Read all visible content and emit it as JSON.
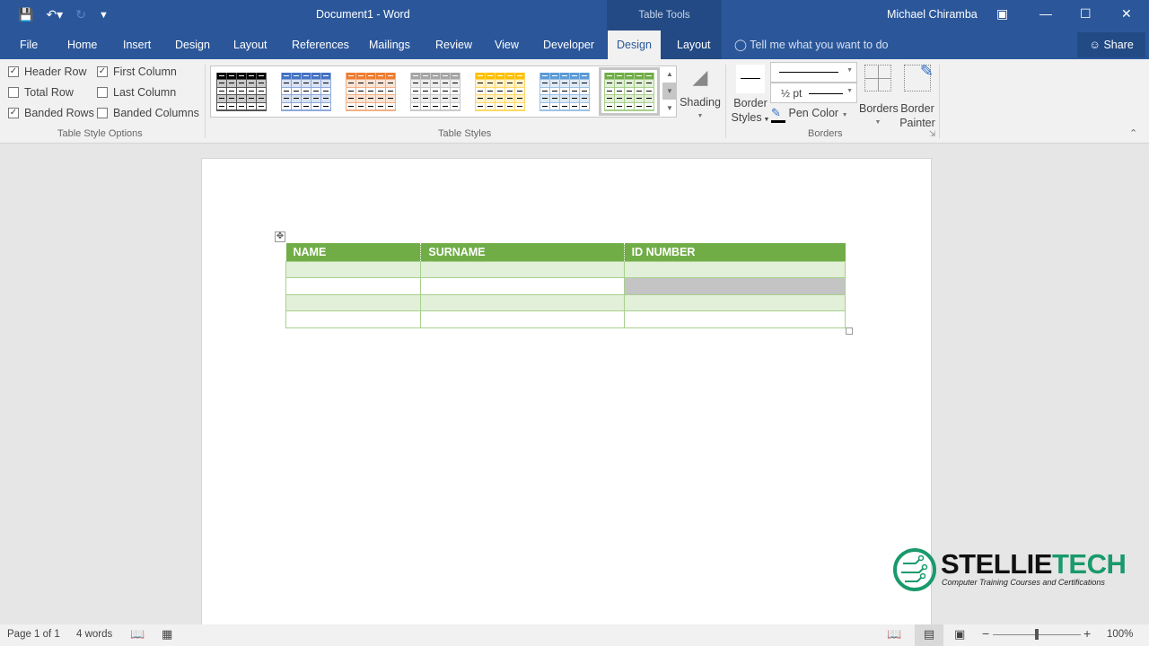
{
  "app": {
    "title": "Document1  -  Word",
    "context_tab_header": "Table Tools",
    "user": "Michael Chiramba"
  },
  "qat": {
    "save_icon": "save-icon",
    "undo_icon": "undo-icon",
    "redo_icon": "redo-icon",
    "customize_icon": "customize-qat-icon"
  },
  "window_controls": {
    "ribbon_display": "ribbon-display-options-icon",
    "minimize": "minimize-icon",
    "maximize": "maximize-icon",
    "close": "close-icon"
  },
  "tabs": [
    {
      "label": "File"
    },
    {
      "label": "Home"
    },
    {
      "label": "Insert"
    },
    {
      "label": "Design"
    },
    {
      "label": "Layout"
    },
    {
      "label": "References"
    },
    {
      "label": "Mailings"
    },
    {
      "label": "Review"
    },
    {
      "label": "View"
    },
    {
      "label": "Developer"
    },
    {
      "label": "Design",
      "active": true,
      "context": true
    },
    {
      "label": "Layout",
      "context": true
    }
  ],
  "tellme": {
    "placeholder": "Tell me what you want to do"
  },
  "share": {
    "label": "Share"
  },
  "ribbon": {
    "style_options": {
      "label": "Table Style Options",
      "items": [
        {
          "label": "Header Row",
          "checked": true
        },
        {
          "label": "Total Row",
          "checked": false
        },
        {
          "label": "Banded Rows",
          "checked": true
        },
        {
          "label": "First Column",
          "checked": true
        },
        {
          "label": "Last Column",
          "checked": false
        },
        {
          "label": "Banded Columns",
          "checked": false
        }
      ]
    },
    "table_styles": {
      "label": "Table Styles",
      "thumbs": [
        {
          "name": "black",
          "header": "#000000",
          "band": "#c9c9c9",
          "line": "#555555"
        },
        {
          "name": "blue",
          "header": "#4472c4",
          "band": "#d9e2f3",
          "line": "#8eaadb"
        },
        {
          "name": "orange",
          "header": "#ed7d31",
          "band": "#fbe4d5",
          "line": "#f4b083"
        },
        {
          "name": "gray",
          "header": "#a5a5a5",
          "band": "#ededed",
          "line": "#c9c9c9"
        },
        {
          "name": "gold",
          "header": "#ffc000",
          "band": "#fff2cc",
          "line": "#ffd965"
        },
        {
          "name": "lightblue",
          "header": "#5b9bd5",
          "band": "#deeaf6",
          "line": "#9cc2e5"
        },
        {
          "name": "green",
          "header": "#70ad47",
          "band": "#e2efd9",
          "line": "#a8d08d",
          "selected": true
        }
      ],
      "shading_label": "Shading"
    },
    "borders": {
      "label": "Borders",
      "border_styles_label_1": "Border",
      "border_styles_label_2": "Styles",
      "weight_value": "½ pt",
      "pen_color_label": "Pen Color",
      "borders_label": "Borders",
      "border_painter_label_1": "Border",
      "border_painter_label_2": "Painter"
    }
  },
  "document": {
    "table": {
      "headers": [
        "NAME",
        "SURNAME",
        "ID NUMBER"
      ],
      "rows": [
        [
          "",
          "",
          ""
        ],
        [
          "",
          "",
          ""
        ],
        [
          "",
          "",
          ""
        ],
        [
          "",
          "",
          ""
        ]
      ],
      "header_color": "#70ad47",
      "band_color": "#e2efd9"
    }
  },
  "logo": {
    "brand_a": "STELLIE",
    "brand_b": "TECH",
    "tagline": "Computer Training Courses and Certifications",
    "color": "#1a9a6c"
  },
  "status": {
    "page": "Page 1 of 1",
    "words": "4 words",
    "zoom": "100%",
    "zoom_fraction": 0.5
  }
}
